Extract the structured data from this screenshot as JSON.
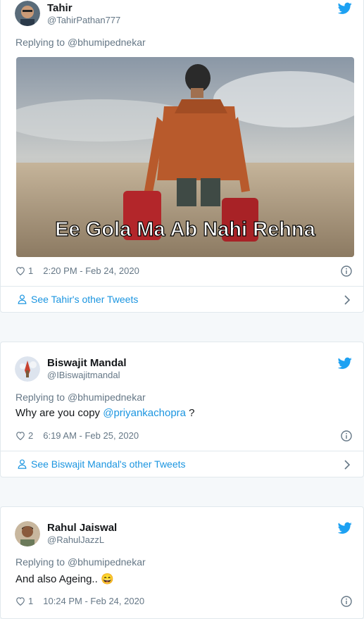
{
  "tweets": [
    {
      "name": "Tahir",
      "handle": "@TahirPathan777",
      "replying_label": "Replying to",
      "replying_to": "@bhumipednekar",
      "likes": "1",
      "time": "2:20 PM - Feb 24, 2020",
      "image_caption": "Ee Gola Ma Ab Nahi Rehna",
      "footer": "See Tahir's other Tweets"
    },
    {
      "name": "Biswajit Mandal",
      "handle": "@IBiswajitmandal",
      "replying_label": "Replying to",
      "replying_to": "@bhumipednekar",
      "text_before": "Why are you copy ",
      "mention": "@priyankachopra",
      "text_after": " ?",
      "likes": "2",
      "time": "6:19 AM - Feb 25, 2020",
      "footer": "See Biswajit Mandal's other Tweets"
    },
    {
      "name": "Rahul Jaiswal",
      "handle": "@RahulJazzL",
      "replying_label": "Replying to",
      "replying_to": "@bhumipednekar",
      "text": "And also Ageing..",
      "emoji": "😄",
      "likes": "1",
      "time": "10:24 PM - Feb 24, 2020"
    }
  ],
  "colors": {
    "link": "#1b95e0",
    "muted": "#657786",
    "border": "#e1e8ed",
    "twitter": "#1da1f2"
  },
  "icons": [
    "twitter-bird-icon",
    "heart-icon",
    "info-icon",
    "person-icon",
    "chevron-right-icon"
  ]
}
